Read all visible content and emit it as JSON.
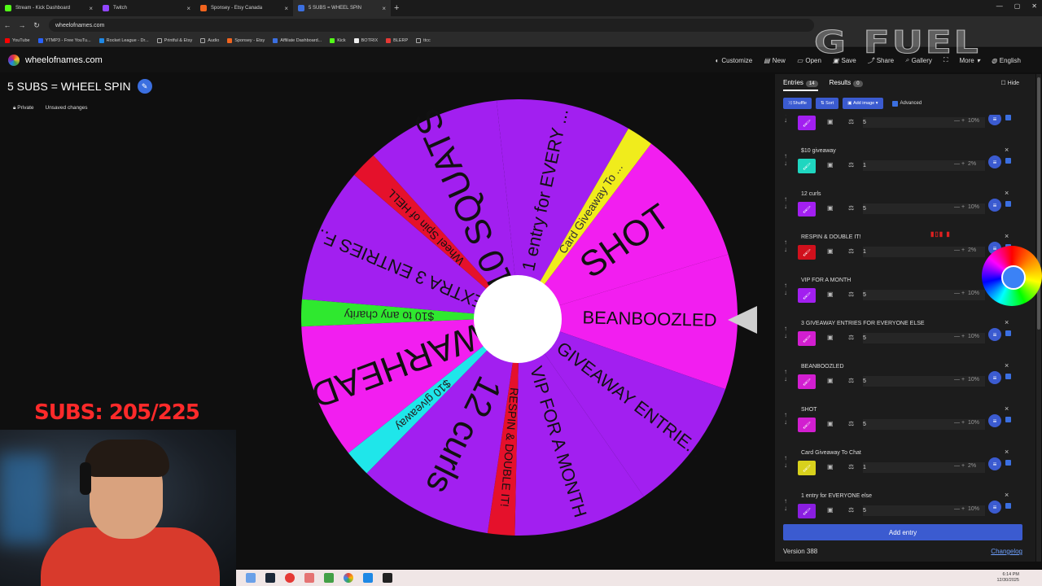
{
  "browser": {
    "tabs": [
      {
        "title": "Stream - Kick Dashboard",
        "color": "#53fc18"
      },
      {
        "title": "Twitch",
        "color": "#9146ff"
      },
      {
        "title": "Sponsey - Etsy Canada",
        "color": "#f1641e"
      },
      {
        "title": "5 SUBS = WHEEL SPIN",
        "color": "#3b6fe0",
        "active": true
      }
    ],
    "url": "wheelofnames.com",
    "bookmarks": [
      "YouTube",
      "YTMP3 - Free YouTu...",
      "Rocket League - Dr...",
      "Printful & Etsy",
      "Audio",
      "Sponsey - Etsy",
      "Affiliate Dashboard...",
      "Kick",
      "BOTRIX",
      "BLERP",
      "ttcc"
    ]
  },
  "site": {
    "name": "wheelofnames.com",
    "menu": [
      "Customize",
      "New",
      "Open",
      "Save",
      "Share",
      "Gallery",
      "More",
      "English"
    ]
  },
  "overlay": {
    "gfuel": "G FUEL",
    "subs": "SUBS: 205/225"
  },
  "wheel": {
    "title": "5 SUBS = WHEEL SPIN",
    "privacy": "Private",
    "unsaved": "Unsaved changes",
    "slices": [
      {
        "label": "1 entry for EVERY ...",
        "color": "#a21ff0",
        "weight": 5
      },
      {
        "label": "Card Giveaway To ...",
        "color": "#f0ec1c",
        "weight": 1
      },
      {
        "label": "SHOT",
        "color": "#f21ef0",
        "weight": 5
      },
      {
        "label": "BEANBOOZLED",
        "color": "#f21ef0",
        "weight": 5
      },
      {
        "label": "3 GIVEAWAY ENTRIE...",
        "color": "#a21ff0",
        "weight": 5
      },
      {
        "label": "VIP FOR A MONTH",
        "color": "#a21ff0",
        "weight": 5
      },
      {
        "label": "RESPIN & DOUBLE IT!",
        "color": "#e5112b",
        "weight": 1
      },
      {
        "label": "12 curls",
        "color": "#a21ff0",
        "weight": 5
      },
      {
        "label": "$10 giveaway",
        "color": "#1fe6ea",
        "weight": 1
      },
      {
        "label": "WARHEAD",
        "color": "#f21ef0",
        "weight": 5
      },
      {
        "label": "$10 to any charity",
        "color": "#2fe82f",
        "weight": 1
      },
      {
        "label": "EXTRA 3 ENTRIES F...",
        "color": "#a21ff0",
        "weight": 5
      },
      {
        "label": "Wheel Spin of HELL",
        "color": "#e5112b",
        "weight": 1
      },
      {
        "label": "10 SQUATS",
        "color": "#a21ff0",
        "weight": 5
      }
    ]
  },
  "panel": {
    "entries_tab": "Entries",
    "entries_count": "14",
    "results_tab": "Results",
    "results_count": "0",
    "hide": "Hide",
    "shuffle": "Shuffle",
    "sort": "Sort",
    "add_image": "Add image",
    "advanced": "Advanced",
    "add_entry": "Add entry",
    "version": "Version 388",
    "changelog": "Changelog",
    "rows": [
      {
        "name": "",
        "weight": "5",
        "pct": "10%",
        "color": "#a21ff0"
      },
      {
        "name": "$10 giveaway",
        "weight": "1",
        "pct": "2%",
        "color": "#1fd6c0"
      },
      {
        "name": "12 curls",
        "weight": "5",
        "pct": "10%",
        "color": "#a21ff0"
      },
      {
        "name": "RESPIN & DOUBLE IT!",
        "weight": "1",
        "pct": "2%",
        "color": "#d0101c"
      },
      {
        "name": "VIP FOR A MONTH",
        "weight": "5",
        "pct": "10%",
        "color": "#a21ff0"
      },
      {
        "name": "3 GIVEAWAY ENTRIES FOR EVERYONE ELSE",
        "weight": "5",
        "pct": "10%",
        "color": "#d21ed0"
      },
      {
        "name": "BEANBOOZLED",
        "weight": "5",
        "pct": "10%",
        "color": "#d21ed0"
      },
      {
        "name": "SHOT",
        "weight": "5",
        "pct": "10%",
        "color": "#d21ed0"
      },
      {
        "name": "Card Giveaway To Chat",
        "weight": "1",
        "pct": "2%",
        "color": "#d8d11c"
      },
      {
        "name": "1 entry for EVERYONE else",
        "weight": "5",
        "pct": "10%",
        "color": "#8a1ee0"
      }
    ]
  },
  "taskbar": {
    "time": "6:14 PM",
    "date": "12/30/2025"
  }
}
